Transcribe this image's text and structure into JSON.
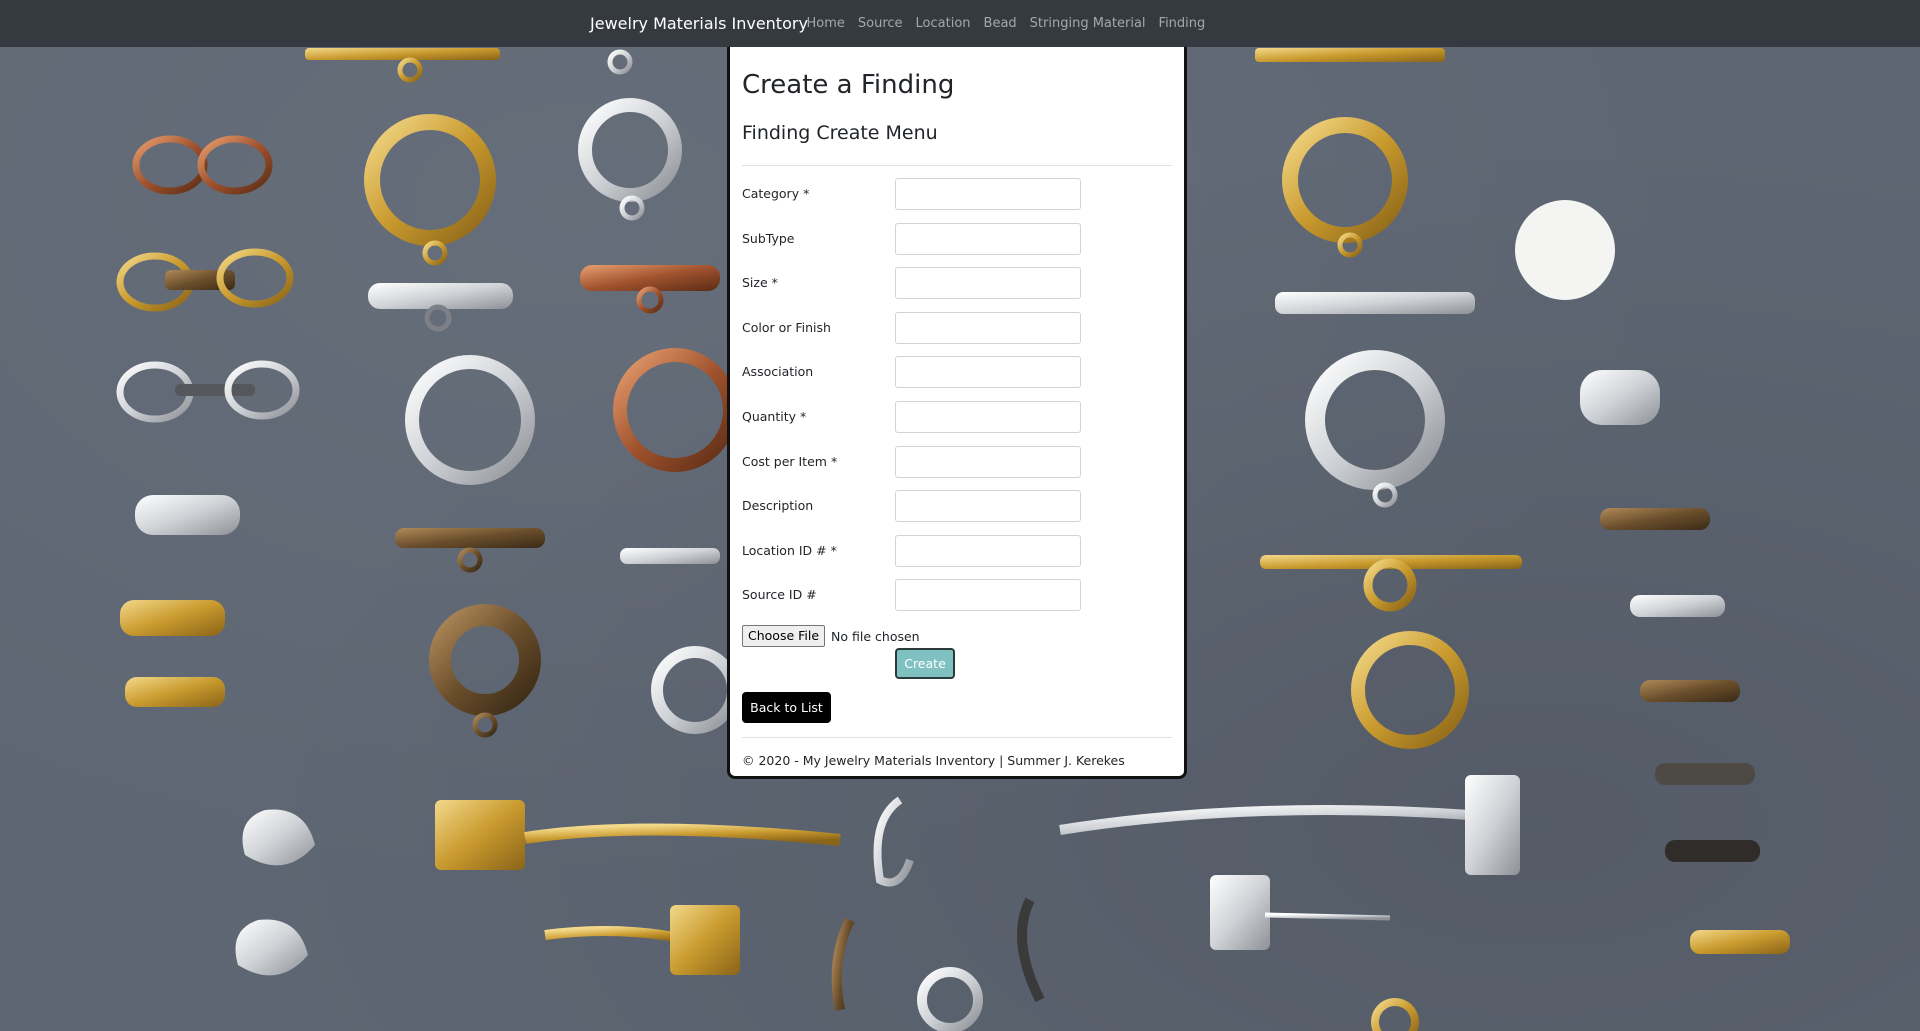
{
  "navbar": {
    "brand": "Jewelry Materials Inventory",
    "links": [
      "Home",
      "Source",
      "Location",
      "Bead",
      "Stringing Material",
      "Finding"
    ]
  },
  "page": {
    "title": "Create a Finding",
    "subtitle": "Finding Create Menu"
  },
  "form": {
    "fields": [
      {
        "label": "Category",
        "required": "*",
        "value": ""
      },
      {
        "label": "SubType",
        "required": "",
        "value": ""
      },
      {
        "label": "Size",
        "required": "*",
        "value": ""
      },
      {
        "label": "Color or Finish",
        "required": "",
        "value": ""
      },
      {
        "label": "Association",
        "required": "",
        "value": ""
      },
      {
        "label": "Quantity",
        "required": "*",
        "value": ""
      },
      {
        "label": "Cost per Item",
        "required": "*",
        "value": ""
      },
      {
        "label": "Description",
        "required": "",
        "value": ""
      },
      {
        "label": "Location ID #",
        "required": "*",
        "value": ""
      },
      {
        "label": "Source ID #",
        "required": "",
        "value": ""
      }
    ],
    "file_button": "Choose File",
    "file_status": "No file chosen",
    "create_label": "Create",
    "back_label": "Back to List"
  },
  "footer": {
    "text": "© 2020 - My Jewelry Materials Inventory | Summer J. Kerekes"
  },
  "colors": {
    "navbar_bg": "#343a40",
    "create_button_bg": "#7fc0c0",
    "back_button_bg": "#000000",
    "background": "#5e6673"
  }
}
